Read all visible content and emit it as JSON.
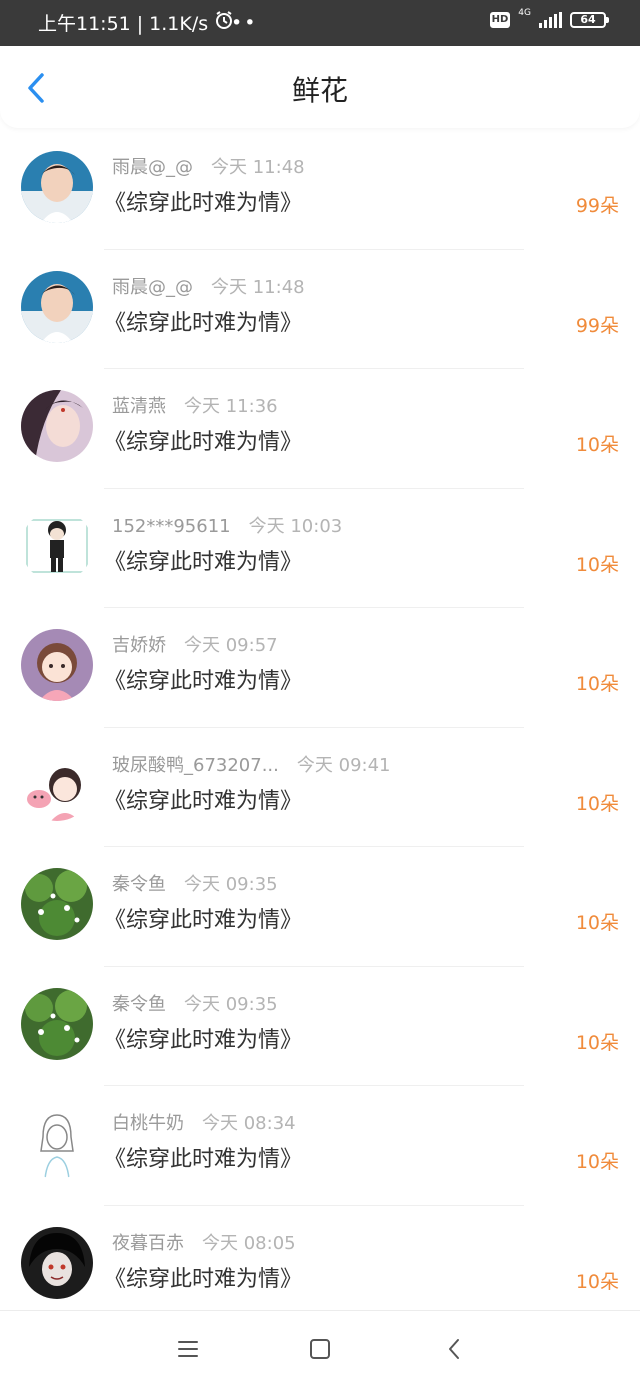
{
  "status_bar": {
    "time": "上午11:51",
    "speed": "1.1K/s",
    "dots": "••",
    "hd": "HD",
    "network": "4G",
    "battery": "64"
  },
  "header": {
    "title": "鲜花"
  },
  "entries": [
    {
      "user": "雨晨@_@",
      "time": "今天 11:48",
      "book": "《综穿此时难为情》",
      "count": "99朵"
    },
    {
      "user": "雨晨@_@",
      "time": "今天 11:48",
      "book": "《综穿此时难为情》",
      "count": "99朵"
    },
    {
      "user": "蓝清燕",
      "time": "今天 11:36",
      "book": "《综穿此时难为情》",
      "count": "10朵"
    },
    {
      "user": "152***95611",
      "time": "今天 10:03",
      "book": "《综穿此时难为情》",
      "count": "10朵"
    },
    {
      "user": "吉娇娇",
      "time": "今天 09:57",
      "book": "《综穿此时难为情》",
      "count": "10朵"
    },
    {
      "user": "玻尿酸鸭_673207...",
      "time": "今天 09:41",
      "book": "《综穿此时难为情》",
      "count": "10朵"
    },
    {
      "user": "秦令鱼",
      "time": "今天 09:35",
      "book": "《综穿此时难为情》",
      "count": "10朵"
    },
    {
      "user": "秦令鱼",
      "time": "今天 09:35",
      "book": "《综穿此时难为情》",
      "count": "10朵"
    },
    {
      "user": "白桃牛奶",
      "time": "今天 08:34",
      "book": "《综穿此时难为情》",
      "count": "10朵"
    },
    {
      "user": "夜暮百赤",
      "time": "今天 08:05",
      "book": "《综穿此时难为情》",
      "count": "10朵"
    }
  ],
  "colors": {
    "accent_blue": "#2b8ff0",
    "flower_orange": "#f08b3b",
    "status_bg": "#3a3a3a"
  },
  "icons": {
    "back": "chevron-left-icon",
    "alarm": "alarm-icon",
    "menu": "menu-icon",
    "home": "home-square-icon",
    "nav_back": "back-triangle-icon"
  }
}
